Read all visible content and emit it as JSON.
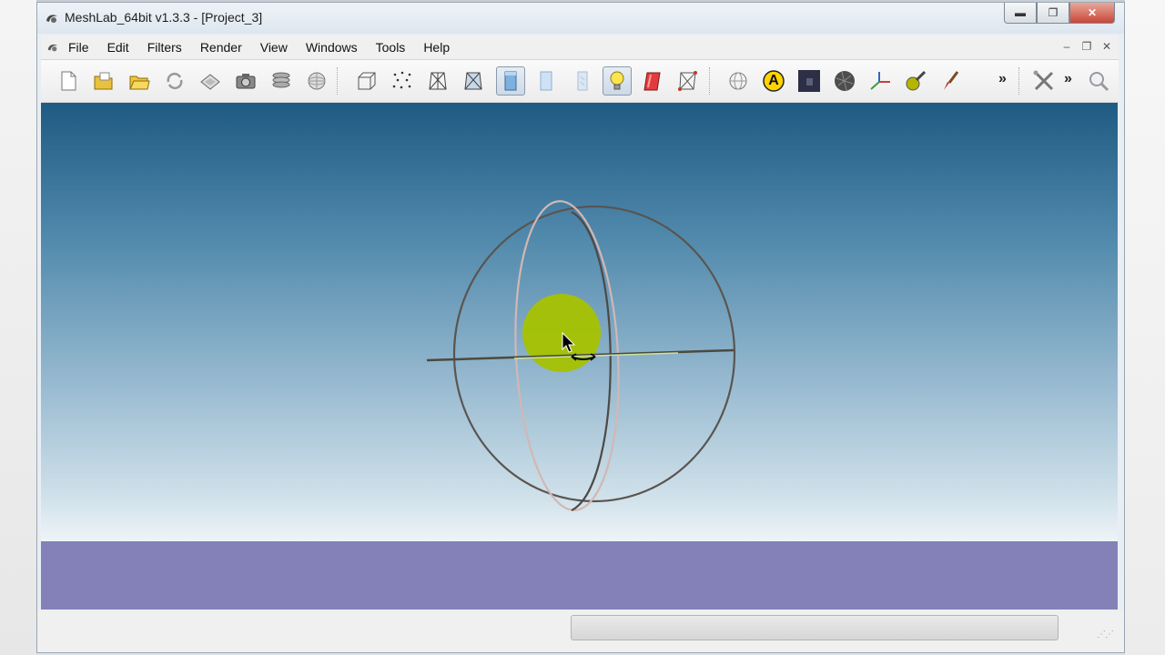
{
  "window": {
    "title": "MeshLab_64bit v1.3.3 - [Project_3]",
    "controls": {
      "minimize": "▬",
      "maximize": "❐",
      "close": "✕"
    }
  },
  "menubar": {
    "items": [
      "File",
      "Edit",
      "Filters",
      "Render",
      "View",
      "Windows",
      "Tools",
      "Help"
    ],
    "mdi_controls": {
      "minimize": "–",
      "restore": "❐",
      "close": "✕"
    }
  },
  "toolbar": {
    "overflow_1": "»",
    "overflow_2": "»",
    "tools": [
      "new-project-icon",
      "open-mesh-icon",
      "open-folder-icon",
      "reload-icon",
      "export-icon",
      "snapshot-icon",
      "layers-icon",
      "sphere-grid-icon",
      "bounding-box-icon",
      "points-icon",
      "wireframe-icon",
      "hidden-lines-icon",
      "flat-icon",
      "smooth-icon",
      "texture-icon",
      "light-icon",
      "color-icon",
      "vertex-select-icon",
      "trackball-icon",
      "annotation-icon",
      "dark-image-icon",
      "textured-sphere-icon",
      "axis-icon",
      "paint-icon",
      "brush-icon",
      "tools-icon",
      "search-icon"
    ],
    "annotation_letter": "A"
  },
  "colors": {
    "viewport_top": "#1f5a82",
    "viewport_bottom": "#eef4f7",
    "bottom_band": "#8381b8",
    "trackball_center": "#a7c200"
  }
}
